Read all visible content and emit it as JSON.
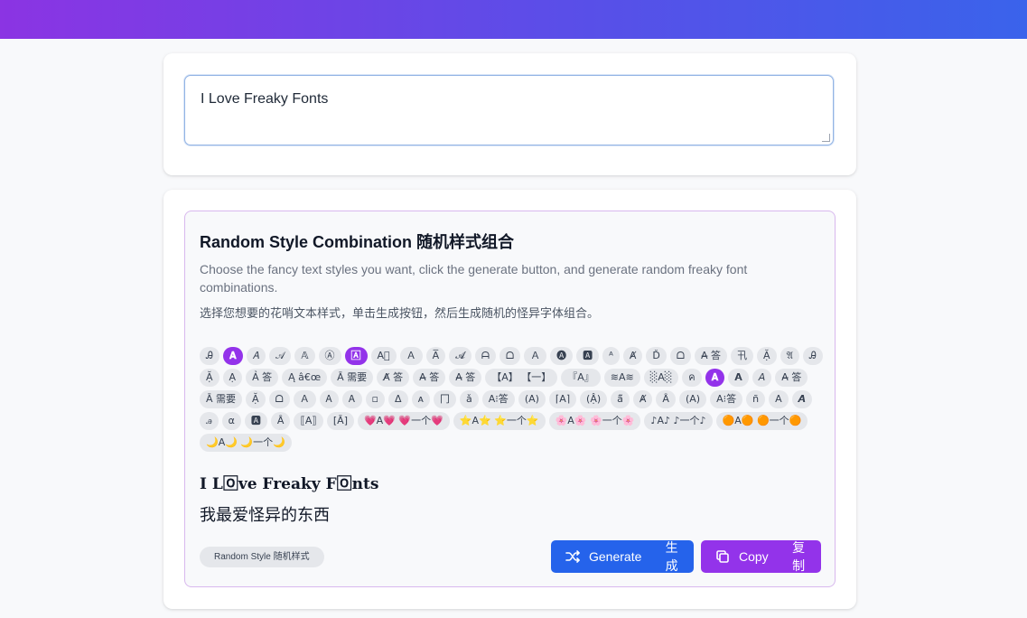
{
  "input": {
    "value": "I Love Freaky Fonts"
  },
  "panel": {
    "title": "Random Style Combination  随机样式组合",
    "desc_en": "Choose the fancy text styles you want, click the generate button, and generate random freaky font combinations.",
    "desc_zh": "选择您想要的花哨文本样式，单击生成按钮，然后生成随机的怪异字体组合。",
    "chips": [
      {
        "label": "Ꭿ",
        "active": false
      },
      {
        "label": "𝐀",
        "active": true
      },
      {
        "label": "𝐴",
        "active": false
      },
      {
        "label": "𝒜",
        "active": false
      },
      {
        "label": "𝔸",
        "active": false
      },
      {
        "label": "Ⓐ",
        "active": false
      },
      {
        "label": "🄰",
        "active": true
      },
      {
        "label": "A⃞",
        "active": false
      },
      {
        "label": "Ａ",
        "active": false
      },
      {
        "label": "A̅",
        "active": false
      },
      {
        "label": "𝓐",
        "active": false
      },
      {
        "label": "ᗩ",
        "active": false
      },
      {
        "label": "ᗝ",
        "active": false
      },
      {
        "label": "Ａ",
        "active": false
      },
      {
        "label": "🅐",
        "active": false
      },
      {
        "label": "🅰",
        "active": false
      },
      {
        "label": "ᴬ",
        "active": false
      },
      {
        "label": "Ⱥ",
        "active": false
      },
      {
        "label": "Ď",
        "active": false
      },
      {
        "label": "ᗝ",
        "active": false
      },
      {
        "label": "A̶ 答",
        "active": false
      },
      {
        "label": "卂",
        "active": false
      },
      {
        "label": "Ặ",
        "active": false
      },
      {
        "label": "𝔄",
        "active": false
      },
      {
        "label": "Ꭿ",
        "active": false
      },
      {
        "label": "Ặ",
        "active": false
      },
      {
        "label": "Ạ",
        "active": false
      },
      {
        "label": "Ả 答",
        "active": false
      },
      {
        "label": "Ą â€œ",
        "active": false
      },
      {
        "label": "Ā 需要",
        "active": false
      },
      {
        "label": "A̸ 答",
        "active": false
      },
      {
        "label": "A̶ 答",
        "active": false
      },
      {
        "label": "A̶ 答",
        "active": false
      },
      {
        "label": "【A】 【一】",
        "active": false
      },
      {
        "label": "『A』",
        "active": false
      },
      {
        "label": "≋A≋",
        "active": false
      },
      {
        "label": "░A░",
        "active": false
      },
      {
        "label": "ค",
        "active": false
      },
      {
        "label": "𝐀",
        "active": true
      },
      {
        "label": "𝗔",
        "active": false
      },
      {
        "label": "𝘈",
        "active": false
      },
      {
        "label": "A̶ 答",
        "active": false
      },
      {
        "label": "Ā 需要",
        "active": false
      },
      {
        "label": "Ặ",
        "active": false
      },
      {
        "label": "ᗝ",
        "active": false
      },
      {
        "label": "Ａ",
        "active": false
      },
      {
        "label": "Ꭺ",
        "active": false
      },
      {
        "label": "Ꭺ",
        "active": false
      },
      {
        "label": "▫",
        "active": false
      },
      {
        "label": "Δ",
        "active": false
      },
      {
        "label": "ᴀ",
        "active": false
      },
      {
        "label": "冂",
        "active": false
      },
      {
        "label": "ǎ",
        "active": false
      },
      {
        "label": "A⁝答",
        "active": false
      },
      {
        "label": "(A)",
        "active": false
      },
      {
        "label": "⌈A⌉",
        "active": false
      },
      {
        "label": "(Ậ)",
        "active": false
      },
      {
        "label": "ā̃",
        "active": false
      },
      {
        "label": "Ⱥ",
        "active": false
      },
      {
        "label": "Ȃ",
        "active": false
      },
      {
        "label": "(A)",
        "active": false
      },
      {
        "label": "A⁝答",
        "active": false
      },
      {
        "label": "ñ",
        "active": false
      },
      {
        "label": "A",
        "active": false
      },
      {
        "label": "𝘼",
        "active": false
      },
      {
        "label": "ꭿ",
        "active": false
      },
      {
        "label": "α",
        "active": false
      },
      {
        "label": "🅰",
        "active": false
      },
      {
        "label": "Ȃ",
        "active": false
      },
      {
        "label": "⟦A⟧",
        "active": false
      },
      {
        "label": "[Ā]",
        "active": false
      },
      {
        "label": "💗A💗  💗一个💗",
        "active": false
      },
      {
        "label": "⭐A⭐  ⭐一个⭐",
        "active": false
      },
      {
        "label": "🌸A🌸  🌸一个🌸",
        "active": false
      },
      {
        "label": "♪A♪ ♪一个♪",
        "active": false
      },
      {
        "label": "🟠A🟠  🟠一个🟠",
        "active": false
      },
      {
        "label": "🌙A🌙  🌙一个🌙",
        "active": false
      }
    ],
    "preview_styled": "I L🄾ve Freaky F🄾nts",
    "preview_zh": "我最爱怪异的东西",
    "tag_label": "Random Style  随机样式",
    "generate_label": "Generate",
    "generate_label_zh": "生成",
    "copy_label": "Copy",
    "copy_label_zh": "复制"
  }
}
